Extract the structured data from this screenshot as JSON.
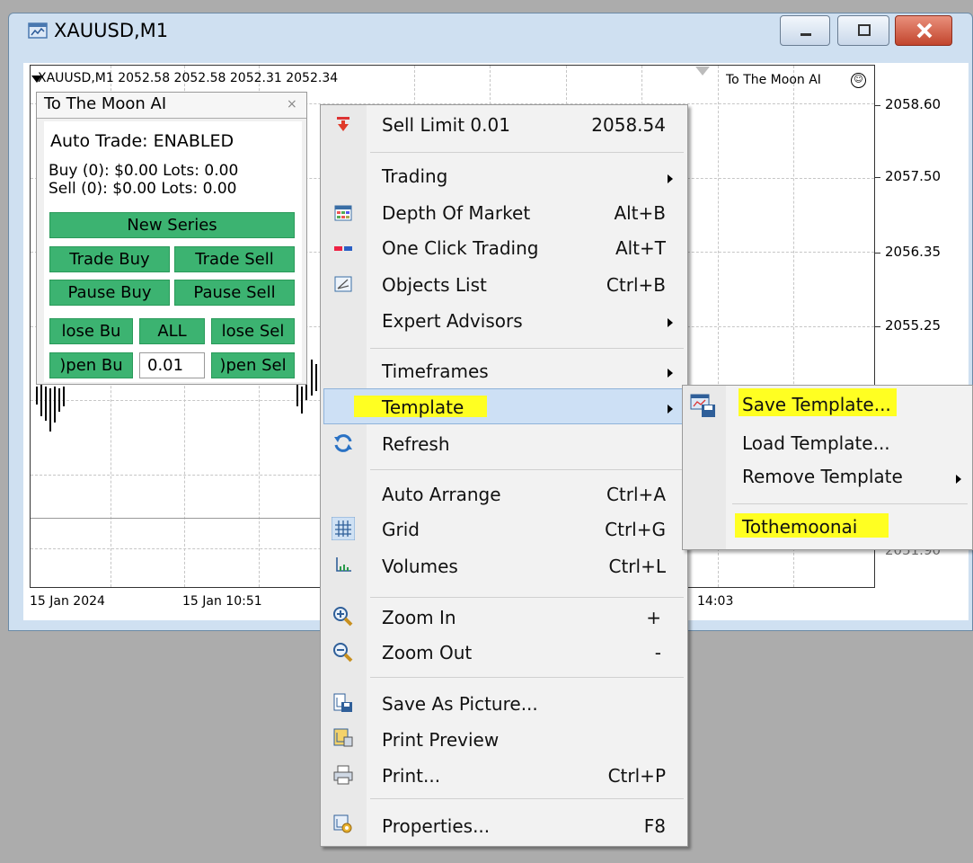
{
  "window": {
    "title": "XAUUSD,M1",
    "icon": "chart-window-icon",
    "buttons": [
      "minimize-icon",
      "maximize-icon",
      "close-icon"
    ]
  },
  "chart": {
    "header": "XAUUSD,M1  2052.58 2052.58 2052.31 2052.34",
    "ea_name": "To The Moon AI",
    "ea_face": "☺",
    "prices": [
      "2058.60",
      "2057.50",
      "2056.35",
      "2055.25",
      "2051.90"
    ],
    "times": [
      "15 Jan 2024",
      "15 Jan 10:51",
      "14:03"
    ]
  },
  "panel": {
    "title": "To The Moon AI",
    "close": "×",
    "auto_trade": "Auto Trade: ENABLED",
    "buy_line": "Buy (0): $0.00 Lots: 0.00",
    "sell_line": "Sell (0): $0.00 Lots: 0.00",
    "new_series": "New Series",
    "trade_buy": "Trade Buy",
    "trade_sell": "Trade Sell",
    "pause_buy": "Pause Buy",
    "pause_sell": "Pause Sell",
    "close_buy": "lose Bu",
    "close_all": "ALL",
    "close_sell": "lose Sel",
    "open_buy": ")pen Bu",
    "lot_value": "0.01",
    "open_sell": ")pen Sel"
  },
  "menu": {
    "items": [
      {
        "label": "Sell Limit 0.01",
        "shortcut": "2058.54",
        "icon": "sell-limit-arrow-icon"
      },
      {
        "label": "Trading",
        "shortcut": "",
        "icon": ""
      },
      {
        "label": "Depth Of Market",
        "shortcut": "Alt+B",
        "icon": "depth-of-market-icon"
      },
      {
        "label": "One Click Trading",
        "shortcut": "Alt+T",
        "icon": "one-click-trading-icon"
      },
      {
        "label": "Objects List",
        "shortcut": "Ctrl+B",
        "icon": "objects-list-icon"
      },
      {
        "label": "Expert Advisors",
        "shortcut": "",
        "icon": ""
      },
      {
        "label": "Timeframes",
        "shortcut": "",
        "icon": ""
      },
      {
        "label": "Template",
        "shortcut": "",
        "icon": ""
      },
      {
        "label": "Refresh",
        "shortcut": "",
        "icon": "refresh-icon"
      },
      {
        "label": "Auto Arrange",
        "shortcut": "Ctrl+A",
        "icon": ""
      },
      {
        "label": "Grid",
        "shortcut": "Ctrl+G",
        "icon": "grid-icon"
      },
      {
        "label": "Volumes",
        "shortcut": "Ctrl+L",
        "icon": "volumes-icon"
      },
      {
        "label": "Zoom In",
        "shortcut": "+",
        "icon": "zoom-in-icon"
      },
      {
        "label": "Zoom Out",
        "shortcut": "-",
        "icon": "zoom-out-icon"
      },
      {
        "label": "Save As Picture...",
        "shortcut": "",
        "icon": "save-picture-icon"
      },
      {
        "label": "Print Preview",
        "shortcut": "",
        "icon": "print-preview-icon"
      },
      {
        "label": "Print...",
        "shortcut": "Ctrl+P",
        "icon": "print-icon"
      },
      {
        "label": "Properties...",
        "shortcut": "F8",
        "icon": "properties-icon"
      }
    ]
  },
  "submenu": {
    "items": [
      {
        "label": "Save Template...",
        "icon": "save-template-icon"
      },
      {
        "label": "Load Template..."
      },
      {
        "label": "Remove Template"
      },
      {
        "label": "Tothemoonai"
      }
    ]
  },
  "colors": {
    "panel_button": "#3cb371",
    "highlight_marker": "#ffff22",
    "menu_selection": "#cde0f5"
  }
}
